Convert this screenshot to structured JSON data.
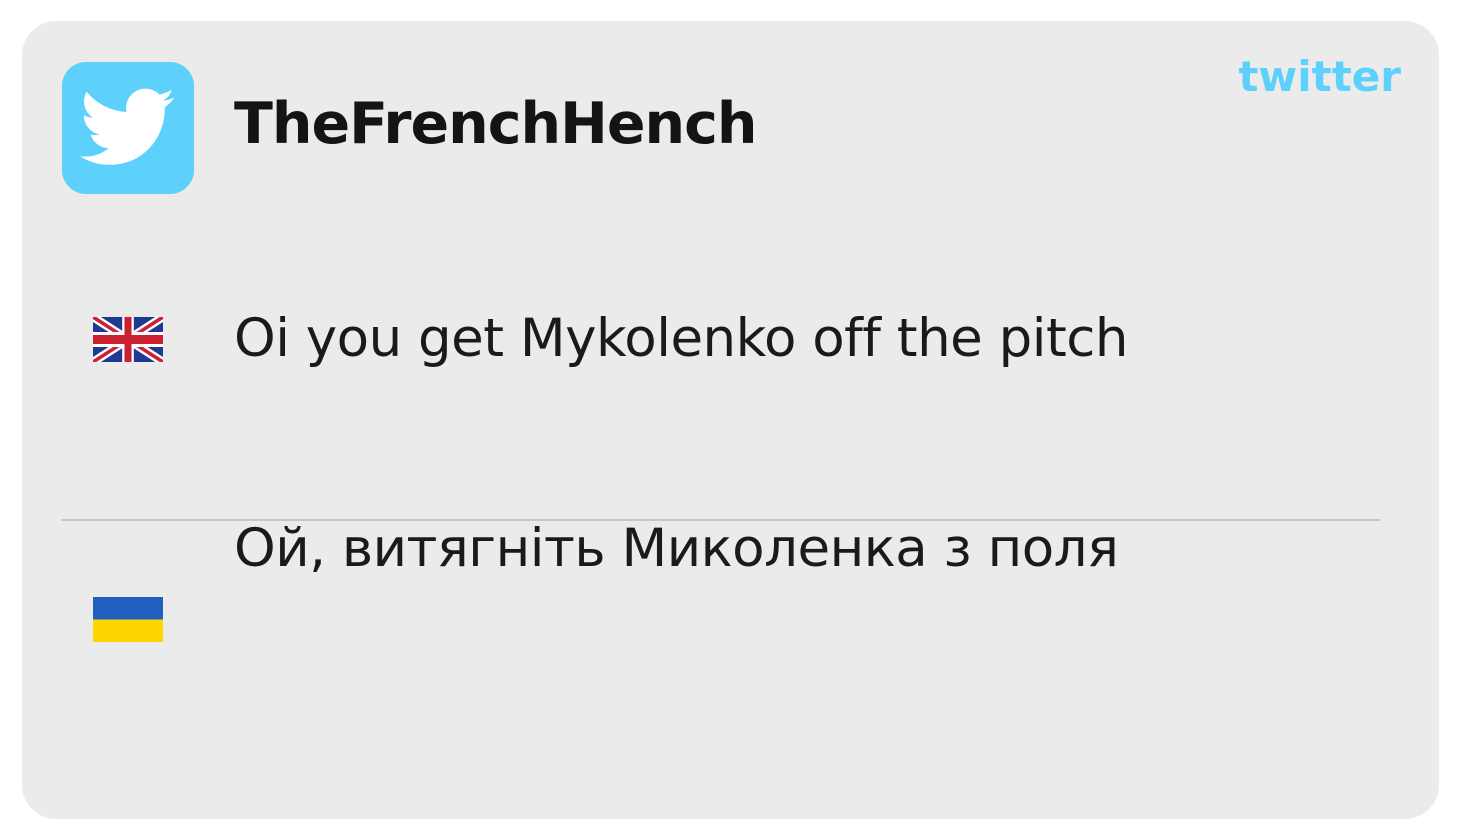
{
  "header": {
    "username": "TheFrenchHench",
    "brand_label": "twitter",
    "logo_icon": "twitter-bird-icon"
  },
  "colors": {
    "card_background": "#ebebeb",
    "brand": "#5dd0fb",
    "text": "#141414",
    "divider": "#c7c7c7"
  },
  "messages": [
    {
      "language_flag": "uk-flag-icon",
      "text": "Oi you get Mykolenko off the pitch"
    },
    {
      "language_flag": "ukraine-flag-icon",
      "text": "Ой, витягніть Миколенка з поля"
    }
  ]
}
